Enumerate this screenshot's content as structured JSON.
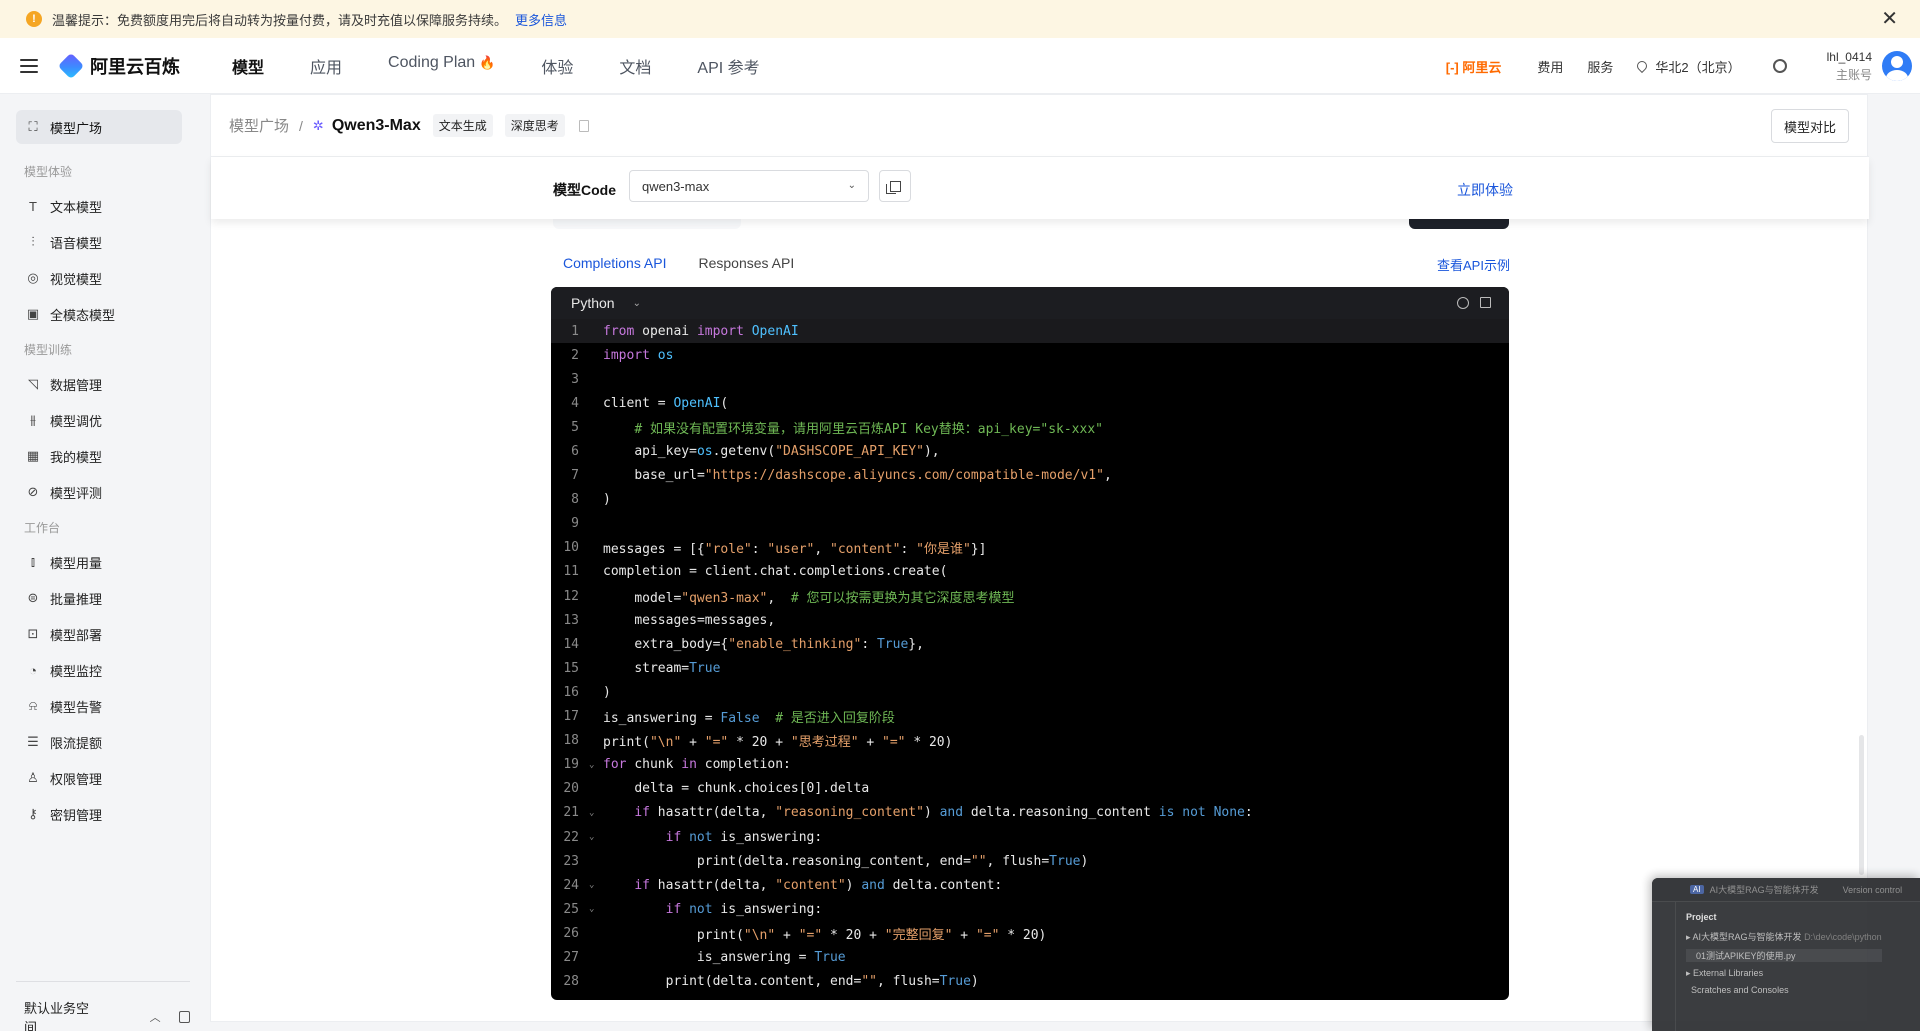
{
  "notice": {
    "text": "温馨提示：免费额度用完后将自动转为按量付费，请及时充值以保障服务持续。",
    "more_link": "更多信息"
  },
  "header": {
    "brand": "阿里云百炼",
    "nav": [
      "模型",
      "应用",
      "Coding Plan",
      "体验",
      "文档",
      "API 参考"
    ],
    "active_nav": "模型",
    "aliyun_label": "[-] 阿里云",
    "links": [
      "费用",
      "服务"
    ],
    "region": "华北2（北京）",
    "user_name": "lhl_0414",
    "user_role": "主账号"
  },
  "sidebar": {
    "top_item": "模型广场",
    "sections": [
      {
        "title": "模型体验",
        "items": [
          "文本模型",
          "语音模型",
          "视觉模型",
          "全模态模型"
        ]
      },
      {
        "title": "模型训练",
        "items": [
          "数据管理",
          "模型调优",
          "我的模型",
          "模型评测"
        ]
      },
      {
        "title": "工作台",
        "items": [
          "模型用量",
          "批量推理",
          "模型部署",
          "模型监控",
          "模型告警",
          "限流提额",
          "权限管理",
          "密钥管理"
        ]
      }
    ],
    "workspace": "默认业务空间"
  },
  "breadcrumb": {
    "root": "模型广场",
    "model": "Qwen3-Max",
    "tags": [
      "文本生成",
      "深度思考"
    ],
    "compare_button": "模型对比"
  },
  "model_code": {
    "label": "模型Code",
    "value": "qwen3-max",
    "try_link": "立即体验"
  },
  "api_tabs": {
    "tabs": [
      "Completions API",
      "Responses API"
    ],
    "active": "Completions API",
    "example_link": "查看API示例"
  },
  "code": {
    "language": "Python",
    "lines": [
      "from openai import OpenAI",
      "import os",
      "",
      "client = OpenAI(",
      "    # 如果没有配置环境变量，请用阿里云百炼API Key替换：api_key=\"sk-xxx\"",
      "    api_key=os.getenv(\"DASHSCOPE_API_KEY\"),",
      "    base_url=\"https://dashscope.aliyuncs.com/compatible-mode/v1\",",
      ")",
      "",
      "messages = [{\"role\": \"user\", \"content\": \"你是谁\"}]",
      "completion = client.chat.completions.create(",
      "    model=\"qwen3-max\",  # 您可以按需更换为其它深度思考模型",
      "    messages=messages,",
      "    extra_body={\"enable_thinking\": True},",
      "    stream=True",
      ")",
      "is_answering = False  # 是否进入回复阶段",
      "print(\"\\n\" + \"=\" * 20 + \"思考过程\" + \"=\" * 20)",
      "for chunk in completion:",
      "    delta = chunk.choices[0].delta",
      "    if hasattr(delta, \"reasoning_content\") and delta.reasoning_content is not None:",
      "        if not is_answering:",
      "            print(delta.reasoning_content, end=\"\", flush=True)",
      "    if hasattr(delta, \"content\") and delta.content:",
      "        if not is_answering:",
      "            print(\"\\n\" + \"=\" * 20 + \"完整回复\" + \"=\" * 20)",
      "            is_answering = True",
      "        print(delta.content, end=\"\", flush=True)"
    ],
    "fold_lines": [
      19,
      21,
      22,
      24,
      25
    ]
  },
  "ide_overlay": {
    "title": "AI大模型RAG与智能体开发",
    "version_control": "Version control",
    "project_label": "Project",
    "root_folder": "AI大模型RAG与智能体开发",
    "root_path": "D:\\dev\\code\\python",
    "file": "01测试APIKEY的使用.py",
    "external": "External Libraries",
    "scratches": "Scratches and Consoles"
  }
}
